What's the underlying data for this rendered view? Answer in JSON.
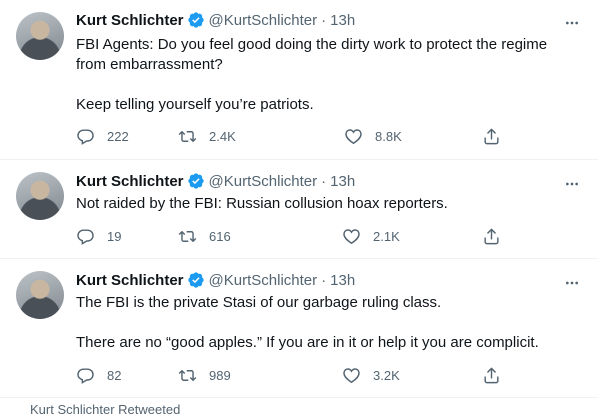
{
  "tweets": [
    {
      "name": "Kurt Schlichter",
      "handle": "@KurtSchlichter",
      "dot": "·",
      "time": "13h",
      "paragraphs": [
        "FBI Agents: Do you feel good doing the dirty work to protect the regime from embarrassment?",
        "Keep telling yourself you’re patriots."
      ],
      "replies": "222",
      "retweets": "2.4K",
      "likes": "8.8K"
    },
    {
      "name": "Kurt Schlichter",
      "handle": "@KurtSchlichter",
      "dot": "·",
      "time": "13h",
      "paragraphs": [
        "Not raided by the FBI: Russian collusion hoax reporters."
      ],
      "replies": "19",
      "retweets": "616",
      "likes": "2.1K"
    },
    {
      "name": "Kurt Schlichter",
      "handle": "@KurtSchlichter",
      "dot": "·",
      "time": "13h",
      "paragraphs": [
        "The FBI is the private Stasi of our garbage ruling class.",
        "There are no “good apples.” If you are in it or help it you are complicit."
      ],
      "replies": "82",
      "retweets": "989",
      "likes": "3.2K"
    }
  ],
  "partial_row": {
    "text": "Kurt Schlichter Retweeted"
  },
  "colors": {
    "verified": "#1d9bf0",
    "secondary_text": "#536471",
    "primary_text": "#0f1419"
  },
  "icons": [
    "verified-badge-icon",
    "more-icon",
    "reply-icon",
    "retweet-icon",
    "like-icon",
    "share-icon"
  ]
}
